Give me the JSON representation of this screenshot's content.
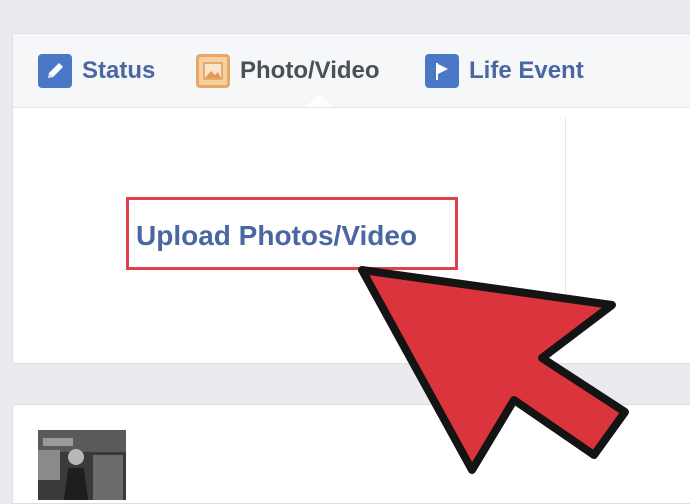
{
  "composer": {
    "tabs": [
      {
        "label": "Status",
        "icon": "pencil-icon"
      },
      {
        "label": "Photo/Video",
        "icon": "photo-icon"
      },
      {
        "label": "Life Event",
        "icon": "flag-icon"
      }
    ],
    "active_tab": "Photo/Video",
    "upload_label": "Upload Photos/Video"
  },
  "feed": {
    "avatar": "profile-photo"
  },
  "colors": {
    "link_blue": "#4b67a1",
    "highlight_red": "#e0404a",
    "arrow_red": "#dc343c"
  }
}
